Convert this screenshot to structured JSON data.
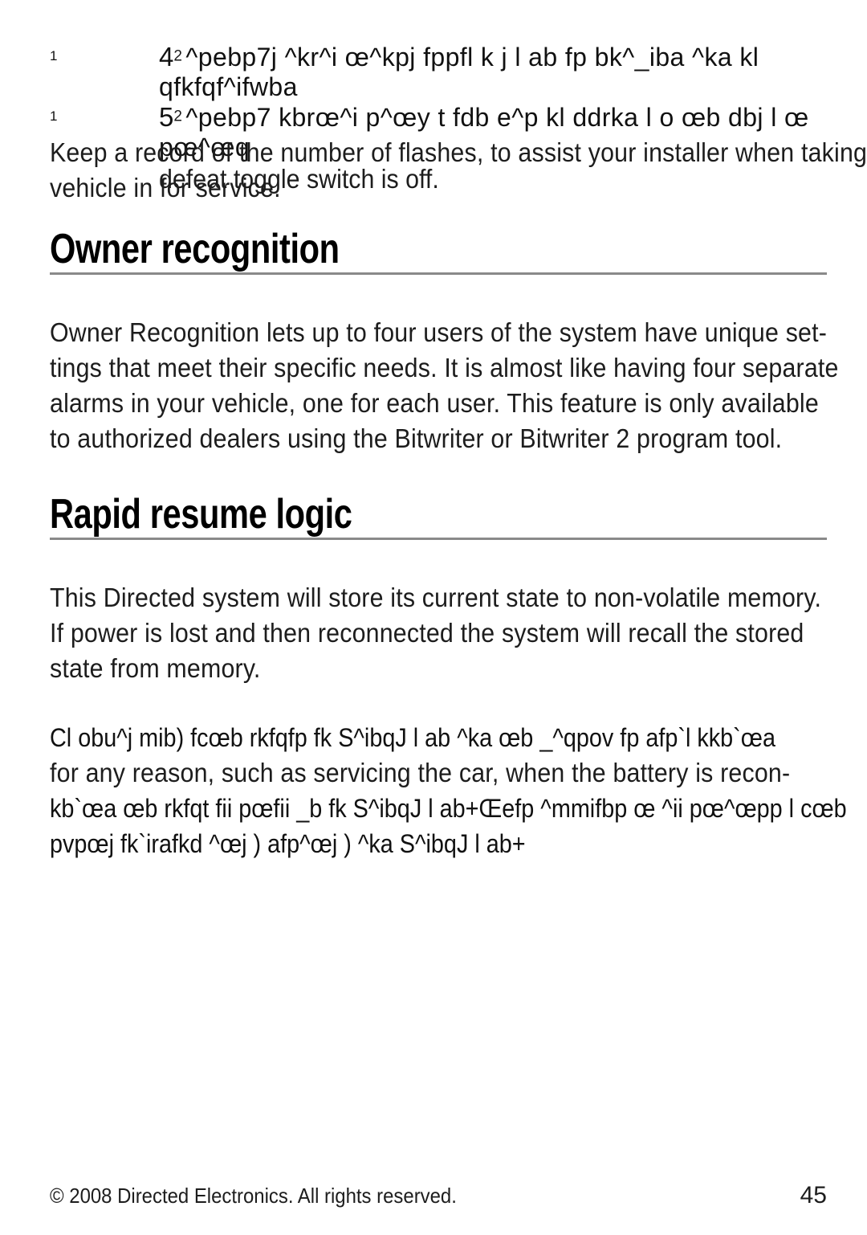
{
  "page": {
    "number": "45",
    "background_color": "#ffffff",
    "text_color": "#1d1d1d",
    "rule_color": "#8a8a8a"
  },
  "steps": [
    {
      "margin_marker": "1",
      "number": "4",
      "superscript": "2",
      "text": "^pebp7j ^kr^i œ^kpj fppfl k j l ab fp bk^_iba ^ka kl qfkfqf^ifwba"
    },
    {
      "margin_marker": "1",
      "number": "5",
      "superscript": "2",
      "text": "^pebp7 kbrœ^i p^œy t fdb e^p kl ddrka l o œb dbj l œ pœ^œq",
      "continuation": "defeat toggle switch is off."
    }
  ],
  "intro_paragraph": {
    "lines": [
      "Keep a record of the number of flashes, to assist your installer when taking the",
      "vehicle in for service."
    ]
  },
  "sections": [
    {
      "heading": "Owner recognition",
      "paragraph_lines": [
        "Owner Recognition lets up to four users of the system have unique set-",
        "tings that meet their specific needs. It is almost like having four separate",
        "alarms in your vehicle, one for each user. This feature is only available",
        "to authorized dealers using the Bitwriter or Bitwriter 2 program tool."
      ]
    },
    {
      "heading": "Rapid resume logic",
      "paragraph_lines": [
        "This Directed system will store its current state to non-volatile memory.",
        "If power is lost and then reconnected the system will recall the stored",
        "state from memory."
      ]
    }
  ],
  "mixed_paragraph": {
    "lines": [
      "Cl obu^j mib) fcœb rkfqfp fk S^ibqJ l ab ^ka œb _^qpov fp afp`l kkb`œa",
      "for any reason, such as servicing the car, when the battery is recon-",
      "kb`œa œb rkfqt fii pœfii _b fk S^ibqJ l ab+Œefp ^mmifbp œ ^ii pœ^œpp l cœb",
      "pvpœj fk`irafkd ^œj ) afp^œj ) ^ka S^ibqJ l ab+"
    ],
    "garbled_flags": [
      true,
      false,
      true,
      true
    ]
  },
  "footer": {
    "copyright": "© 2008 Directed Electronics. All rights reserved.",
    "page_number": "45"
  }
}
